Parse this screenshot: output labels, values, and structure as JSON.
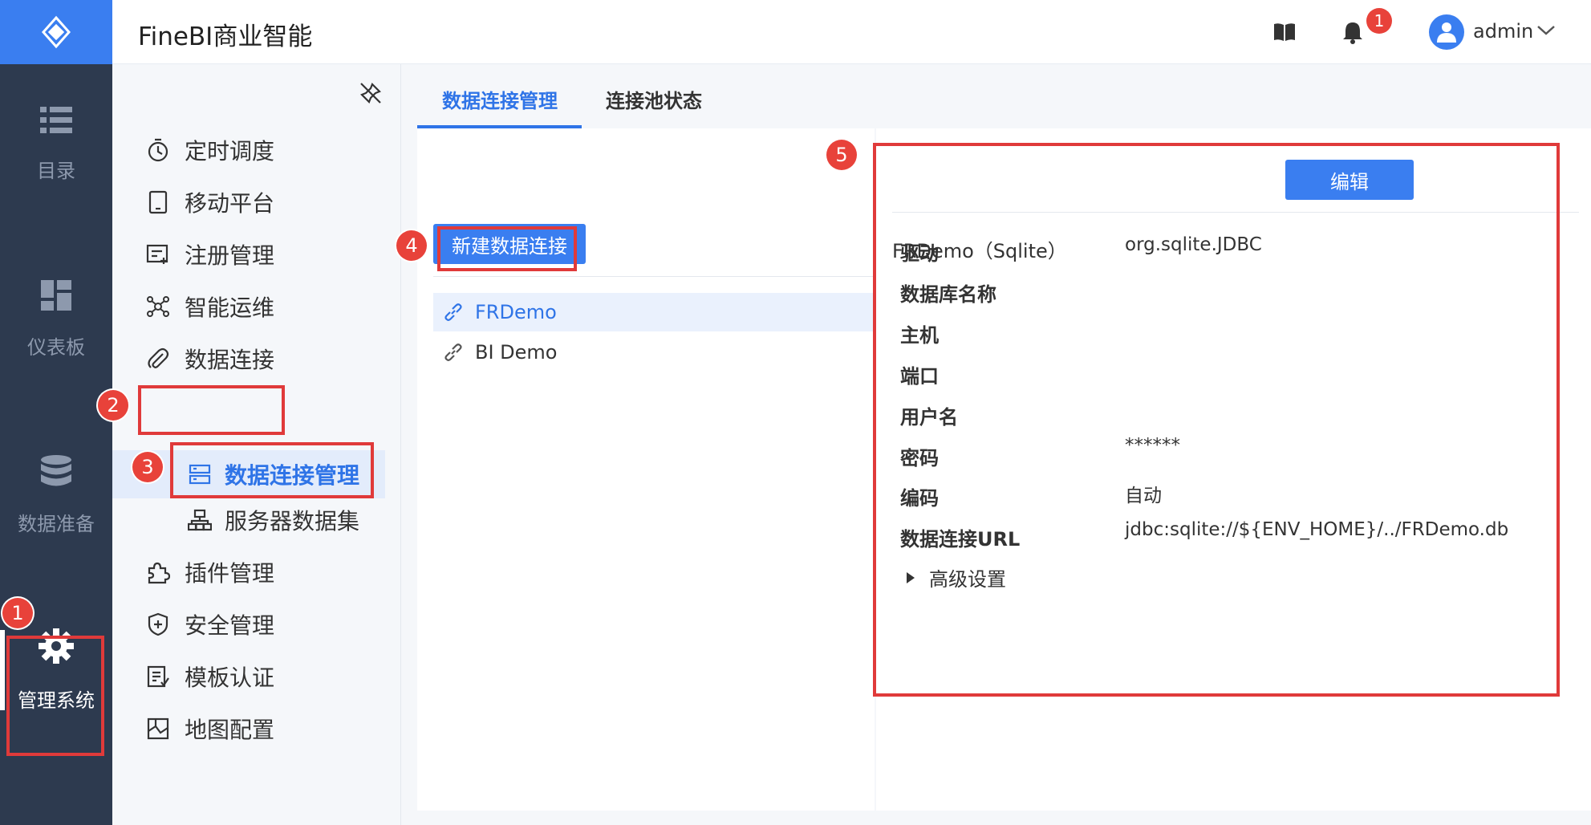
{
  "header": {
    "app_title": "FineBI商业智能",
    "notification_count": "1",
    "user_name": "admin"
  },
  "rail": {
    "items": [
      {
        "label": "目录",
        "icon": "list-icon"
      },
      {
        "label": "仪表板",
        "icon": "dashboard-icon"
      },
      {
        "label": "数据准备",
        "icon": "database-icon"
      },
      {
        "label": "管理系统",
        "icon": "gear-icon",
        "active": true
      }
    ]
  },
  "subnav": {
    "items": [
      {
        "label": "定时调度",
        "icon": "stopwatch-icon"
      },
      {
        "label": "移动平台",
        "icon": "tablet-icon"
      },
      {
        "label": "注册管理",
        "icon": "register-icon"
      },
      {
        "label": "智能运维",
        "icon": "network-icon"
      },
      {
        "label": "数据连接",
        "icon": "paperclip-icon"
      },
      {
        "label": "插件管理",
        "icon": "puzzle-icon"
      },
      {
        "label": "安全管理",
        "icon": "shield-icon"
      },
      {
        "label": "模板认证",
        "icon": "document-icon"
      },
      {
        "label": "地图配置",
        "icon": "map-icon"
      }
    ],
    "sub_items": [
      {
        "label": "数据连接管理",
        "icon": "server-icon",
        "active": true
      },
      {
        "label": "服务器数据集",
        "icon": "hierarchy-icon"
      }
    ]
  },
  "main": {
    "tabs": [
      {
        "label": "数据连接管理",
        "active": true
      },
      {
        "label": "连接池状态"
      }
    ],
    "new_button": "新建数据连接",
    "connections": [
      {
        "name": "FRDemo",
        "selected": true
      },
      {
        "name": "BI Demo"
      }
    ]
  },
  "detail": {
    "title": "FRDemo（Sqlite）",
    "edit_button": "编辑",
    "fields": [
      {
        "label": "驱动",
        "value": "org.sqlite.JDBC"
      },
      {
        "label": "数据库名称",
        "value": ""
      },
      {
        "label": "主机",
        "value": ""
      },
      {
        "label": "端口",
        "value": ""
      },
      {
        "label": "用户名",
        "value": ""
      },
      {
        "label": "密码",
        "value": "******"
      },
      {
        "label": "编码",
        "value": "自动"
      },
      {
        "label": "数据连接URL",
        "value": "jdbc:sqlite://${ENV_HOME}/../FRDemo.db"
      }
    ],
    "advanced": "高级设置"
  },
  "annotations": {
    "steps": [
      "1",
      "2",
      "3",
      "4",
      "5"
    ],
    "color": "#e03a3a"
  },
  "colors": {
    "accent": "#3a7ef0",
    "rail_bg": "#2d3a4f",
    "active_text": "#2f74e7"
  }
}
